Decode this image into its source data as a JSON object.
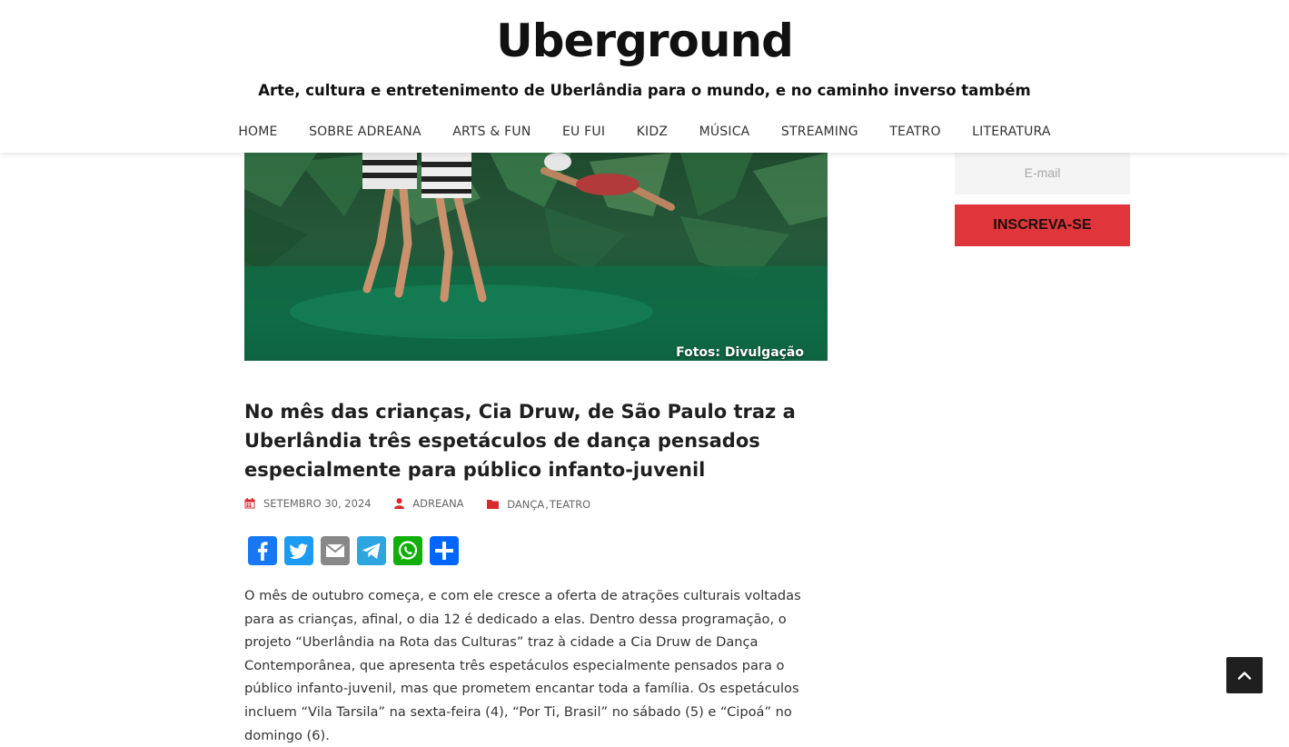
{
  "site": {
    "title": "Uberground",
    "tagline": "Arte, cultura e entretenimento de Uberlândia para o mundo, e no caminho inverso também"
  },
  "nav": {
    "items": [
      {
        "label": "HOME"
      },
      {
        "label": "SOBRE ADREANA"
      },
      {
        "label": "ARTS & FUN"
      },
      {
        "label": "EU FUI"
      },
      {
        "label": "KIDZ"
      },
      {
        "label": "MÚSICA"
      },
      {
        "label": "STREAMING"
      },
      {
        "label": "TEATRO"
      },
      {
        "label": "LITERATURA"
      }
    ]
  },
  "featured_image": {
    "credit": "Fotos: Divulgação"
  },
  "post": {
    "title": "No mês das crianças, Cia Druw, de São Paulo traz a Uberlândia três espetáculos de dança pensados especialmente para público infanto-juvenil",
    "date": "SETEMBRO 30, 2024",
    "author": "ADREANA",
    "categories": [
      "DANÇA",
      "TEATRO"
    ],
    "category_separator": ",",
    "body": "O mês de outubro começa, e com ele cresce a oferta de atrações culturais voltadas para as crianças, afinal, o dia 12 é dedicado a elas. Dentro dessa programação, o projeto “Uberlândia na Rota das Culturas” traz à cidade a Cia Druw de Dança Contemporânea, que apresenta três espetáculos especialmente pensados para o público infanto-juvenil, mas que prometem encantar toda a família. Os espetáculos incluem “Vila Tarsila” na sexta-feira (4), “Por Ti, Brasil” no sábado (5) e “Cipoá” no domingo (6)."
  },
  "share": {
    "buttons": [
      {
        "network": "facebook",
        "icon": "facebook-icon",
        "color": "#1877f2"
      },
      {
        "network": "twitter",
        "icon": "twitter-icon",
        "color": "#1d9bf0"
      },
      {
        "network": "email",
        "icon": "email-icon",
        "color": "#888888"
      },
      {
        "network": "telegram",
        "icon": "telegram-icon",
        "color": "#2ca5e0"
      },
      {
        "network": "whatsapp",
        "icon": "whatsapp-icon",
        "color": "#12af0a"
      },
      {
        "network": "share",
        "icon": "share-icon",
        "color": "#0166ff"
      }
    ]
  },
  "sidebar": {
    "email_placeholder": "E-mail",
    "email_value": "",
    "subscribe_label": "INSCREVA-SE"
  },
  "colors": {
    "accent_red": "#e0363b",
    "meta_icon_red": "#d9272e"
  }
}
